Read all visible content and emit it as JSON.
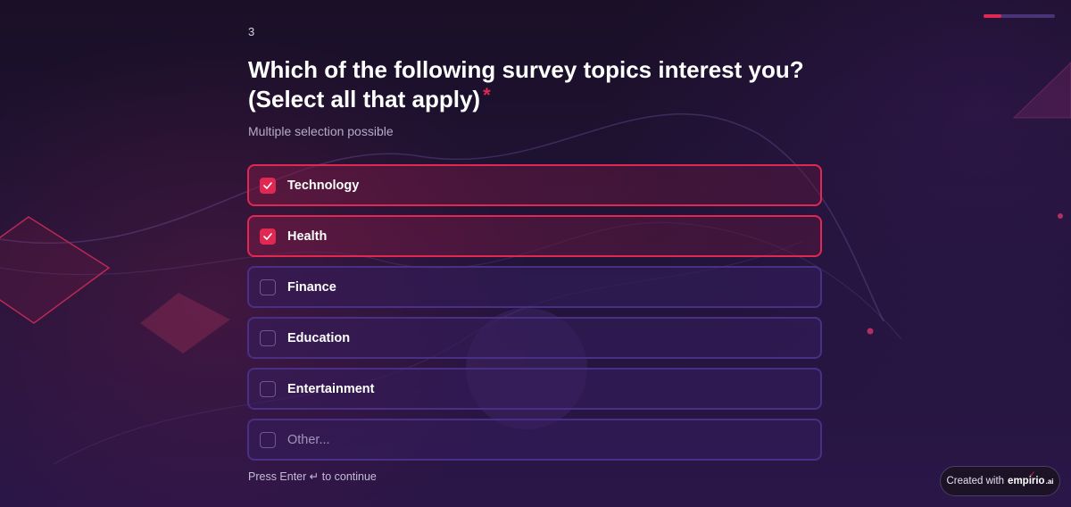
{
  "progress": {
    "fraction": 0.25,
    "track_color": "#4a3478",
    "fill_color": "#e02853"
  },
  "question": {
    "number": "3",
    "title": "Which of the following survey topics interest you? (Select all that apply)",
    "required_mark": "*",
    "subtitle": "Multiple selection possible"
  },
  "options": [
    {
      "label": "Technology",
      "selected": true
    },
    {
      "label": "Health",
      "selected": true
    },
    {
      "label": "Finance",
      "selected": false
    },
    {
      "label": "Education",
      "selected": false
    },
    {
      "label": "Entertainment",
      "selected": false
    }
  ],
  "other_option": {
    "placeholder": "Other...",
    "selected": false
  },
  "hint": {
    "text": "Press Enter ↵ to continue"
  },
  "badge": {
    "prefix": "Created with",
    "brand": "empirio",
    "brand_suffix": ".ai"
  },
  "colors": {
    "accent": "#e02853",
    "background": "#1e1233",
    "option_border": "#4a2f86"
  },
  "icons": {
    "check": "check-icon"
  }
}
